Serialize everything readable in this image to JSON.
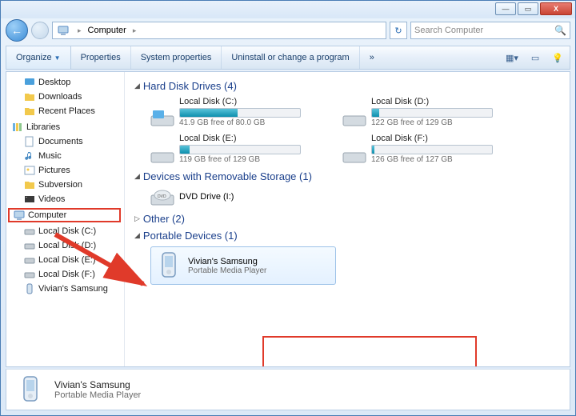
{
  "window": {
    "title": "Computer"
  },
  "addressbar": {
    "location": "Computer",
    "search_placeholder": "Search Computer"
  },
  "toolbar": {
    "organize": "Organize",
    "properties": "Properties",
    "system_properties": "System properties",
    "uninstall": "Uninstall or change a program",
    "more": "»"
  },
  "sidebar": {
    "desktop": "Desktop",
    "downloads": "Downloads",
    "recent": "Recent Places",
    "libraries": "Libraries",
    "documents": "Documents",
    "music": "Music",
    "pictures": "Pictures",
    "subversion": "Subversion",
    "videos": "Videos",
    "computer": "Computer",
    "ld_c": "Local Disk (C:)",
    "ld_d": "Local Disk (D:)",
    "ld_e": "Local Disk (E:)",
    "ld_f": "Local Disk (F:)",
    "samsung": "Vivian's Samsung"
  },
  "sections": {
    "hdd": "Hard Disk Drives (4)",
    "removable": "Devices with Removable Storage (1)",
    "other": "Other (2)",
    "portable": "Portable Devices (1)"
  },
  "drives": {
    "c": {
      "name": "Local Disk (C:)",
      "sub": "41.9 GB free of 80.0 GB",
      "pct": 48
    },
    "d": {
      "name": "Local Disk (D:)",
      "sub": "122 GB free of 129 GB",
      "pct": 6
    },
    "e": {
      "name": "Local Disk (E:)",
      "sub": "119 GB free of 129 GB",
      "pct": 8
    },
    "f": {
      "name": "Local Disk (F:)",
      "sub": "126 GB free of 127 GB",
      "pct": 2
    }
  },
  "dvd": {
    "name": "DVD Drive (I:)"
  },
  "portable_device": {
    "name": "Vivian's Samsung",
    "type": "Portable Media Player"
  },
  "details": {
    "name": "Vivian's Samsung",
    "type": "Portable Media Player"
  }
}
